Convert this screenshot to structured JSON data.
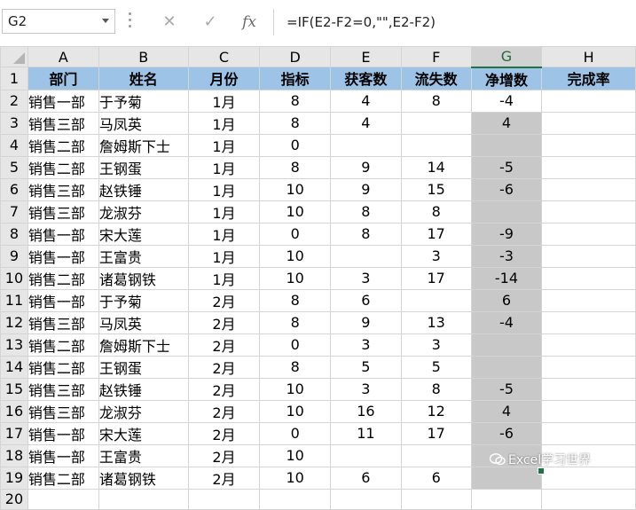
{
  "formula_bar": {
    "name_box": "G2",
    "cancel_symbol": "✕",
    "enter_symbol": "✓",
    "fx_symbol": "fx",
    "formula": "=IF(E2-F2=0,\"\",E2-F2)"
  },
  "columns": [
    "A",
    "B",
    "C",
    "D",
    "E",
    "F",
    "G",
    "H"
  ],
  "row_numbers": [
    "1",
    "2",
    "3",
    "4",
    "5",
    "6",
    "7",
    "8",
    "9",
    "10",
    "11",
    "12",
    "13",
    "14",
    "15",
    "16",
    "17",
    "18",
    "19",
    "20"
  ],
  "headers": [
    "部门",
    "姓名",
    "月份",
    "指标",
    "获客数",
    "流失数",
    "净增数",
    "完成率"
  ],
  "rows": [
    [
      "销售一部",
      "于予菊",
      "1月",
      "8",
      "4",
      "8",
      "-4",
      ""
    ],
    [
      "销售三部",
      "马凤英",
      "1月",
      "8",
      "4",
      "",
      "4",
      ""
    ],
    [
      "销售二部",
      "詹姆斯下士",
      "1月",
      "0",
      "",
      "",
      "",
      ""
    ],
    [
      "销售二部",
      "王钢蛋",
      "1月",
      "8",
      "9",
      "14",
      "-5",
      ""
    ],
    [
      "销售三部",
      "赵铁锤",
      "1月",
      "10",
      "9",
      "15",
      "-6",
      ""
    ],
    [
      "销售三部",
      "龙淑芬",
      "1月",
      "10",
      "8",
      "8",
      "",
      ""
    ],
    [
      "销售一部",
      "宋大莲",
      "1月",
      "0",
      "8",
      "17",
      "-9",
      ""
    ],
    [
      "销售一部",
      "王富贵",
      "1月",
      "10",
      "",
      "3",
      "-3",
      ""
    ],
    [
      "销售二部",
      "诸葛钢铁",
      "1月",
      "10",
      "3",
      "17",
      "-14",
      ""
    ],
    [
      "销售一部",
      "于予菊",
      "2月",
      "8",
      "6",
      "",
      "6",
      ""
    ],
    [
      "销售三部",
      "马凤英",
      "2月",
      "8",
      "9",
      "13",
      "-4",
      ""
    ],
    [
      "销售二部",
      "詹姆斯下士",
      "2月",
      "0",
      "3",
      "3",
      "",
      ""
    ],
    [
      "销售二部",
      "王钢蛋",
      "2月",
      "8",
      "5",
      "5",
      "",
      ""
    ],
    [
      "销售三部",
      "赵铁锤",
      "2月",
      "10",
      "3",
      "8",
      "-5",
      ""
    ],
    [
      "销售三部",
      "龙淑芬",
      "2月",
      "10",
      "16",
      "12",
      "4",
      ""
    ],
    [
      "销售一部",
      "宋大莲",
      "2月",
      "0",
      "11",
      "17",
      "-6",
      ""
    ],
    [
      "销售一部",
      "王富贵",
      "2月",
      "10",
      "",
      "",
      "",
      ""
    ],
    [
      "销售二部",
      "诸葛钢铁",
      "2月",
      "10",
      "6",
      "6",
      "",
      ""
    ]
  ],
  "watermark": "Excel学习世界",
  "colors": {
    "header_fill": "#9dc3e6",
    "selection_fill": "#c8c8c8",
    "selection_border": "#217346"
  }
}
